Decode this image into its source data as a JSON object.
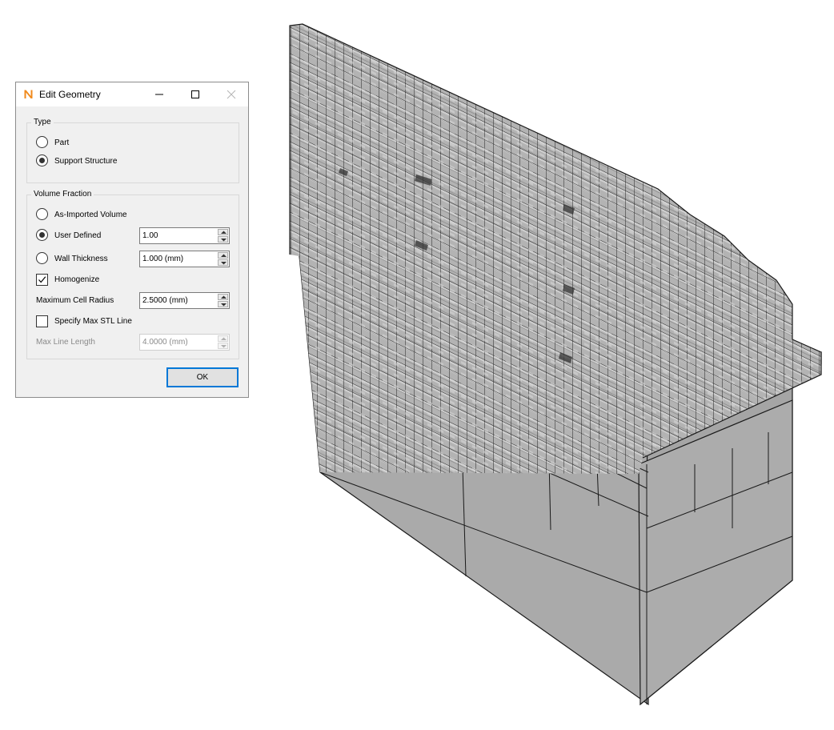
{
  "dialog": {
    "title": "Edit Geometry",
    "app_icon": "n-logo-icon",
    "controls": {
      "minimize": "minimize-icon",
      "maximize": "maximize-icon",
      "close": "close-icon"
    },
    "type_group": {
      "legend": "Type",
      "options": [
        {
          "label": "Part",
          "checked": false
        },
        {
          "label": "Support Structure",
          "checked": true
        }
      ]
    },
    "volume_group": {
      "legend": "Volume Fraction",
      "as_imported": {
        "label": "As-Imported Volume",
        "checked": false
      },
      "user_defined": {
        "label": "User Defined",
        "checked": true,
        "value": "1.00"
      },
      "wall_thickness": {
        "label": "Wall Thickness",
        "checked": false,
        "value": "1.000 (mm)"
      },
      "homogenize": {
        "label": "Homogenize",
        "checked": true
      },
      "max_cell_radius": {
        "label": "Maximum Cell Radius",
        "value": "2.5000 (mm)"
      },
      "specify_max_stl": {
        "label": "Specify Max STL Line",
        "checked": false
      },
      "max_line_length": {
        "label": "Max Line Length",
        "value": "4.0000 (mm)",
        "enabled": false
      }
    },
    "ok_label": "OK"
  },
  "viewport": {
    "description_icon": "voxel-mesh",
    "colors": {
      "face": "#a9a9a9",
      "top_face": "#bdbdbd",
      "edge": "#1a1a1a",
      "background": "#ffffff"
    }
  }
}
